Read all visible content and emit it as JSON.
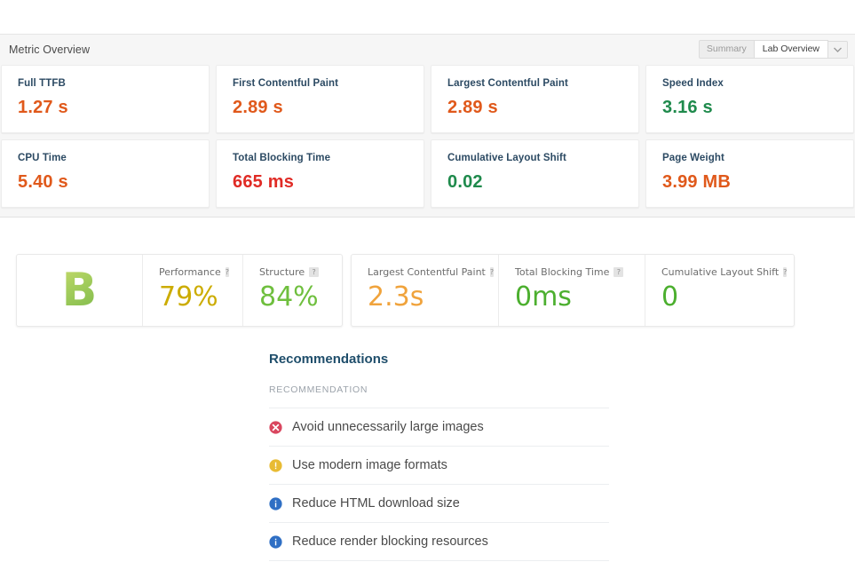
{
  "panel": {
    "title": "Metric Overview",
    "controls": {
      "summary_label": "Summary",
      "view_selected": "Lab Overview",
      "dropdown_icon": "chevron-down-icon"
    }
  },
  "metrics": [
    {
      "label": "Full TTFB",
      "value": "1.27 s",
      "color": "#e0591b"
    },
    {
      "label": "First Contentful Paint",
      "value": "2.89 s",
      "color": "#e0591b"
    },
    {
      "label": "Largest Contentful Paint",
      "value": "2.89 s",
      "color": "#e0591b"
    },
    {
      "label": "Speed Index",
      "value": "3.16 s",
      "color": "#1f8a4c"
    },
    {
      "label": "CPU Time",
      "value": "5.40 s",
      "color": "#e0591b"
    },
    {
      "label": "Total Blocking Time",
      "value": "665 ms",
      "color": "#e02b25"
    },
    {
      "label": "Cumulative Layout Shift",
      "value": "0.02",
      "color": "#1f8a4c"
    },
    {
      "label": "Page Weight",
      "value": "3.99 MB",
      "color": "#e0591b"
    }
  ],
  "scores": {
    "grade": "B",
    "grade_color": "#8cc152",
    "cells": [
      {
        "name": "Performance",
        "value": "79%",
        "color": "#ccac00",
        "help": "?"
      },
      {
        "name": "Structure",
        "value": "84%",
        "color": "#6fbf3e",
        "help": "?"
      },
      {
        "name": "Largest Contentful Paint",
        "value": "2.3s",
        "color": "#f0a33c",
        "help": "?"
      },
      {
        "name": "Total Blocking Time",
        "value": "0ms",
        "color": "#4caf2f",
        "help": "?"
      },
      {
        "name": "Cumulative Layout Shift",
        "value": "0",
        "color": "#4caf2f",
        "help": "?"
      }
    ]
  },
  "recommendations": {
    "title": "Recommendations",
    "column_header": "RECOMMENDATION",
    "items": [
      {
        "text": "Avoid unnecessarily large images",
        "icon": "error-circle-icon",
        "icon_color": "#d9465f",
        "glyph": "x"
      },
      {
        "text": "Use modern image formats",
        "icon": "warning-circle-icon",
        "icon_color": "#e8bb33",
        "glyph": "!"
      },
      {
        "text": "Reduce HTML download size",
        "icon": "info-circle-icon",
        "icon_color": "#2f6fc4",
        "glyph": "i"
      },
      {
        "text": "Reduce render blocking resources",
        "icon": "info-circle-icon",
        "icon_color": "#2f6fc4",
        "glyph": "i"
      }
    ]
  }
}
